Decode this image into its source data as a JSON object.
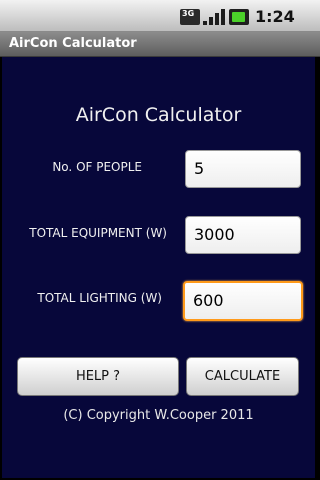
{
  "status_bar": {
    "network_badge": "3G",
    "icons": [
      "network-3g-icon",
      "signal-strength-icon",
      "battery-charging-icon"
    ],
    "time": "1:24 pm"
  },
  "app": {
    "title": "AirCon Calculator"
  },
  "form": {
    "heading": "AirCon Calculator",
    "people_label": "No. OF PEOPLE",
    "people_value": "5",
    "equipment_label": "TOTAL EQUIPMENT (W)",
    "equipment_value": "3000",
    "lighting_label": "TOTAL LIGHTING (W)",
    "lighting_value": "600"
  },
  "buttons": {
    "help": "HELP ?",
    "calculate": "CALCULATE"
  },
  "footer": {
    "copyright": "(C) Copyright W.Cooper 2011"
  },
  "colors": {
    "background": "#07073a",
    "focus_border": "#ff9a1a"
  }
}
